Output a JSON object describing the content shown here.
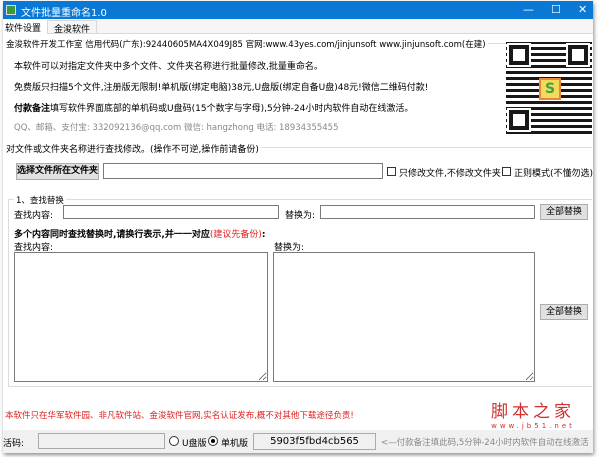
{
  "window": {
    "title": "文件批量重命名1.0",
    "minimize": "—",
    "maximize": "☐",
    "close": "✕",
    "accent": "#0a79d6"
  },
  "tabs": [
    {
      "label": "软件设置",
      "active": true
    },
    {
      "label": "金浚软件",
      "active": false
    }
  ],
  "info": {
    "group_title": "金浚软件开发工作室 信用代码(广东):92440605MA4X049J85 官网:www.43yes.com/jinjunsoft  www.jinjunsoft.com(在建)",
    "line1": "本软件可以对指定文件夹中多个文件、文件夹名称进行批量修改,批量重命名。",
    "line2": "免费版只扫描5个文件,注册版无限制!单机版(绑定电脑)38元,U盘版(绑定自备U盘)48元!微信二维码付款!",
    "line3_bold": "付款备注",
    "line3": "填写软件界面底部的单机码或U盘码(15个数字与字母),5分钟-24小时内软件自动在线激活。",
    "contact": "QQ、邮箱、支付宝: 332092136@qq.com    微信: hangzhong    电话: 18934355455"
  },
  "main": {
    "group_title": "对文件或文件夹名称进行查找修改。(操作不可逆,操作前请备份)",
    "select_folder_button": "选择文件所在文件夹",
    "folder_path": "",
    "only_files_checkbox": {
      "label": "只修改文件,不修改文件夹",
      "checked": false
    },
    "regex_checkbox": {
      "label": "正则模式(不懂勿选)",
      "checked": false
    }
  },
  "find_replace": {
    "group_title": "1、查找替换",
    "find_label": "查找内容:",
    "find_value": "",
    "replace_label": "替换为:",
    "replace_value": "",
    "replace_all_button": "全部替换",
    "multi_hint": "多个内容同时查找替换时,请换行表示,并一一对应",
    "multi_hint_red": "(建议先备份)",
    "multi_hint_colon": ":",
    "multi_find_label": "查找内容:",
    "multi_find_value": "",
    "multi_replace_label": "替换为:",
    "multi_replace_value": "",
    "multi_replace_all_button": "全部替换"
  },
  "notice": "本软件只在华军软件园、非凡软件站、金浚软件官网,实名认证发布,概不对其他下载途径负责!",
  "watermark": {
    "title": "脚本之家",
    "url": "www.jb51.net"
  },
  "footer": {
    "activation_label": "激活码:",
    "activation_value": "",
    "usb_radio": {
      "label": "U盘版",
      "checked": false
    },
    "pc_radio": {
      "label": "单机版",
      "checked": true
    },
    "machine_code": "5903f5fbd4cb565",
    "hint": "<—付款备注填此码,5分钟-24小时内软件自动在线激活"
  }
}
